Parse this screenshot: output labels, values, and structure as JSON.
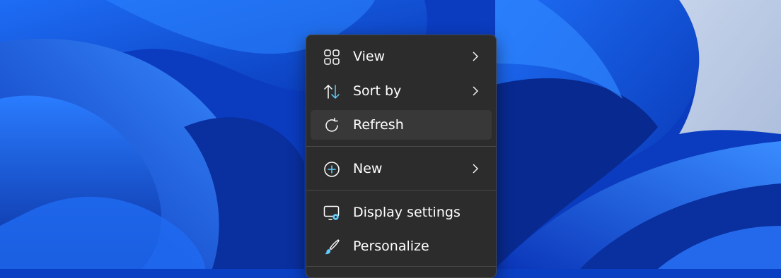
{
  "colors": {
    "menu_bg": "#2c2c2c",
    "hover_bg": "#383838",
    "text": "#ffffff",
    "icon_accent": "#60cdff",
    "wallpaper_blue": "#0a3fc4"
  },
  "context_menu": {
    "items": [
      {
        "label": "View",
        "icon": "grid-icon",
        "has_submenu": true
      },
      {
        "label": "Sort by",
        "icon": "sort-arrows-icon",
        "has_submenu": true
      },
      {
        "label": "Refresh",
        "icon": "refresh-icon",
        "has_submenu": false,
        "highlighted": true
      },
      {
        "label": "New",
        "icon": "plus-circle-icon",
        "has_submenu": true
      },
      {
        "label": "Display settings",
        "icon": "display-settings-icon",
        "has_submenu": false
      },
      {
        "label": "Personalize",
        "icon": "paintbrush-icon",
        "has_submenu": false
      }
    ]
  }
}
